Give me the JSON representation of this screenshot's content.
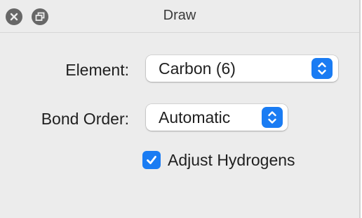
{
  "window": {
    "title": "Draw",
    "close_icon": "close-icon",
    "float_icon": "detach-window-icon"
  },
  "form": {
    "element_label": "Element:",
    "element_value": "Carbon (6)",
    "bond_order_label": "Bond Order:",
    "bond_order_value": "Automatic",
    "adjust_hydrogens_label": "Adjust Hydrogens",
    "adjust_hydrogens_checked": true
  },
  "colors": {
    "accent": "#1a7cf3",
    "window_bg": "#ececec",
    "titlebar_button": "#676767"
  }
}
